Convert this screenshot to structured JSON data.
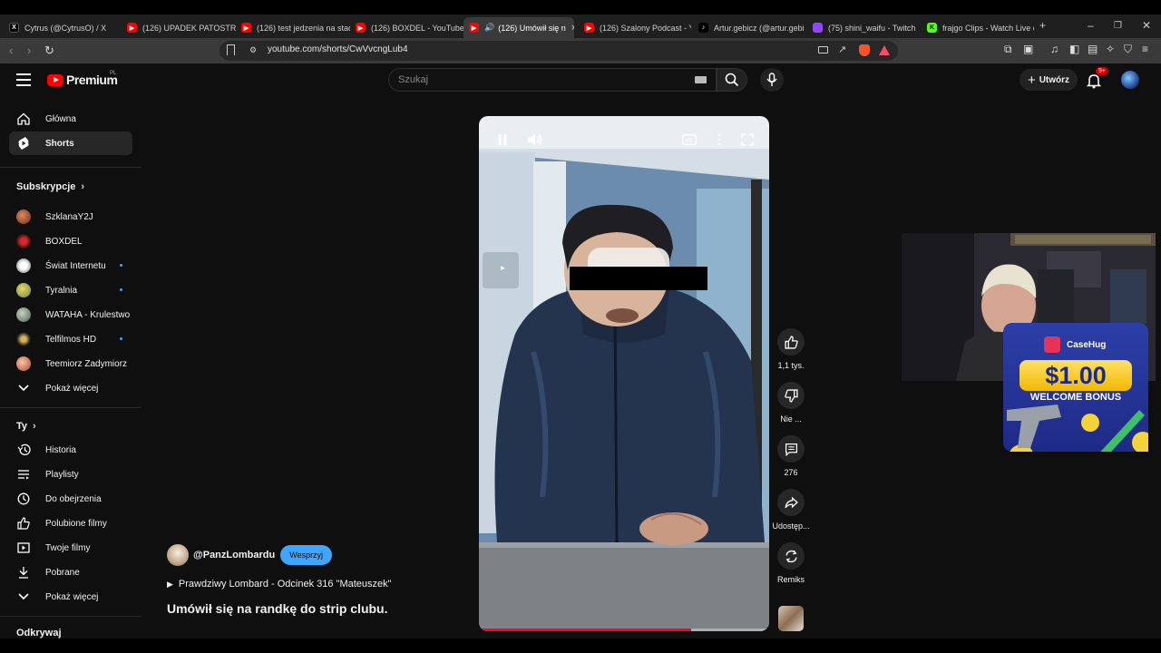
{
  "browser": {
    "tabs": [
      {
        "title": "Cytrus (@CytrusO) / X",
        "site": "x"
      },
      {
        "title": "(126) UPADEK PATOSTREA",
        "site": "youtube"
      },
      {
        "title": "(126) test jedzenia na stac",
        "site": "youtube"
      },
      {
        "title": "(126) BOXDEL - YouTube",
        "site": "youtube"
      },
      {
        "title": "(126) Umówił się n",
        "site": "youtube",
        "active": true
      },
      {
        "title": "(126) Szalony Podcast - Yo",
        "site": "youtube"
      },
      {
        "title": "Artur.gebicz (@artur.gebi",
        "site": "tiktok"
      },
      {
        "title": "(75) shini_waifu - Twitch",
        "site": "twitch"
      },
      {
        "title": "frajgo Clips - Watch Live o",
        "site": "kick"
      }
    ],
    "url": "youtube.com/shorts/CwVvcngLub4"
  },
  "youtube": {
    "logo_text": "Premium",
    "logo_region": "PL",
    "search_placeholder": "Szukaj",
    "create_label": "Utwórz",
    "notification_count": "9+"
  },
  "sidebar": {
    "primary": [
      {
        "label": "Główna",
        "icon": "home-icon"
      },
      {
        "label": "Shorts",
        "icon": "shorts-icon",
        "active": true
      }
    ],
    "subscriptions_header": "Subskrypcje",
    "subscriptions": [
      {
        "label": "SzklanaY2J",
        "color": "#b3542e",
        "dot": false
      },
      {
        "label": "BOXDEL",
        "color": "#6a1f1f",
        "dot": false
      },
      {
        "label": "Świat Internetu",
        "color": "#e8e8e8",
        "dot": true
      },
      {
        "label": "Tyralnia",
        "color": "#c9b24a",
        "dot": true
      },
      {
        "label": "WATAHA - Krulestwo",
        "color": "#8a9a8a",
        "dot": false
      },
      {
        "label": "Telfilmos HD",
        "color": "#2b2b2b",
        "dot": true
      },
      {
        "label": "Teemiorz Zadymiorz",
        "color": "#d07b5a",
        "dot": false
      }
    ],
    "show_more_subs": "Pokaż więcej",
    "you_header": "Ty",
    "you_items": [
      {
        "label": "Historia",
        "icon": "history-icon"
      },
      {
        "label": "Playlisty",
        "icon": "playlist-icon"
      },
      {
        "label": "Do obejrzenia",
        "icon": "watch-later-icon"
      },
      {
        "label": "Polubione filmy",
        "icon": "thumb-up-icon"
      },
      {
        "label": "Twoje filmy",
        "icon": "your-videos-icon"
      },
      {
        "label": "Pobrane",
        "icon": "download-icon"
      },
      {
        "label": "Pokaż więcej",
        "icon": "chevron-down-icon"
      }
    ],
    "explore_header": "Odkrywaj"
  },
  "short": {
    "channel": "@PanzLombardu",
    "support_label": "Wesprzyj",
    "playlist": "Prawdziwy Lombard - Odcinek 316 \"Mateuszek\"",
    "title": "Umówił się na randkę do strip clubu.",
    "progress": 0.73,
    "likes": "1,1 tys.",
    "dislike_label": "Nie ...",
    "comments": "276",
    "share_label": "Udostęp...",
    "remix_label": "Remiks"
  },
  "overlay": {
    "promo_brand": "CaseHug",
    "promo_amount": "$1.00",
    "promo_text": "WELCOME BONUS"
  },
  "colors": {
    "accent_red": "#ff0000",
    "support_blue": "#3ea6ff",
    "progress_red": "#ff0033",
    "background": "#0f0f0f"
  }
}
